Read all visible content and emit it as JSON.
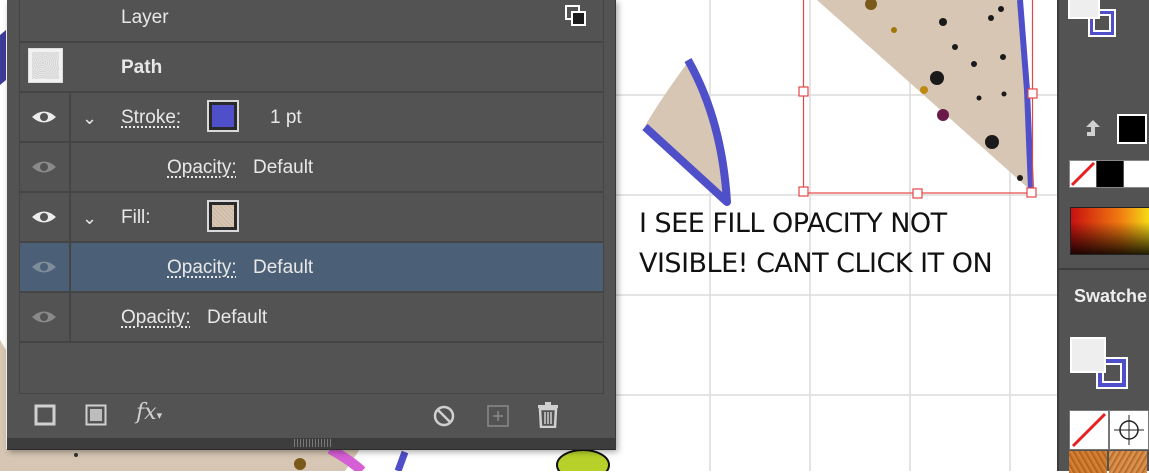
{
  "panel": {
    "rows": [
      {
        "label": "Layer"
      },
      {
        "label": "Path"
      },
      {
        "label": "Stroke:",
        "value": "1 pt"
      },
      {
        "label": "Opacity:",
        "value": "Default"
      },
      {
        "label": "Fill:"
      },
      {
        "label": "Opacity:",
        "value": "Default"
      },
      {
        "label": "Opacity:",
        "value": "Default"
      }
    ],
    "bottom_tools": {
      "fx_label": "fx"
    }
  },
  "annotation": {
    "line1": "I SEE FILL OPACITY NOT",
    "line2": "VISIBLE! CANT CLICK IT ON"
  },
  "right_panel": {
    "swatches_label": "Swatche"
  },
  "colors": {
    "panel_bg": "#535353",
    "selected_row": "#4b6076",
    "stroke_color": "#4f4fc9",
    "fill_tan": "#d6c6b3",
    "selection_red": "#e64545"
  }
}
